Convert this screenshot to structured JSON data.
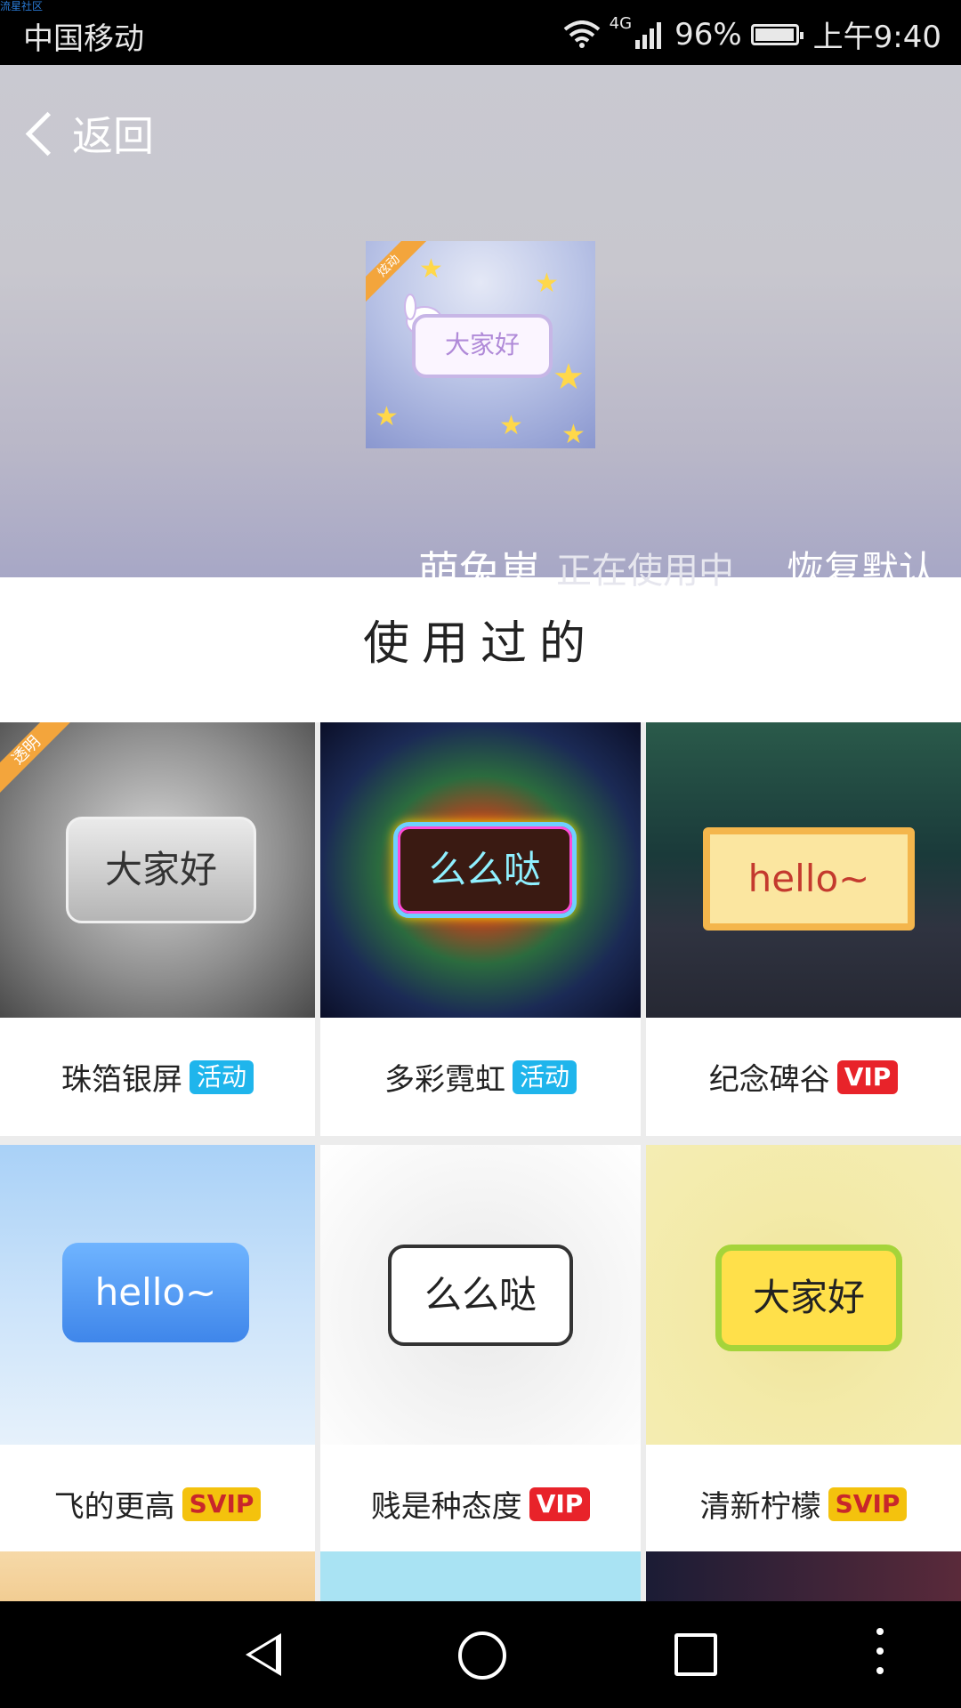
{
  "watermark": "流星社区",
  "status_bar": {
    "carrier": "中国移动",
    "network": "4G",
    "battery": "96%",
    "time": "上午9:40"
  },
  "header": {
    "back_label": "返回",
    "preview": {
      "ribbon": "炫动",
      "bubble_text": "大家好"
    },
    "current_name": "萌兔崽",
    "current_status": "正在使用中",
    "restore_label": "恢复默认"
  },
  "section": {
    "title": "使用过的"
  },
  "items": [
    {
      "name": "珠箔银屏",
      "badge": "活动",
      "badge_type": "activity",
      "sample": "大家好",
      "ribbon": "透明"
    },
    {
      "name": "多彩霓虹",
      "badge": "活动",
      "badge_type": "activity",
      "sample": "么么哒"
    },
    {
      "name": "纪念碑谷",
      "badge": "VIP",
      "badge_type": "vip",
      "sample": "hello~"
    },
    {
      "name": "飞的更高",
      "badge": "SVIP",
      "badge_type": "svip",
      "sample": "hello~"
    },
    {
      "name": "贱是种态度",
      "badge": "VIP",
      "badge_type": "vip",
      "sample": "么么哒"
    },
    {
      "name": "清新柠檬",
      "badge": "SVIP",
      "badge_type": "svip",
      "sample": "大家好"
    }
  ],
  "colors": {
    "activity": "#1fb5ec",
    "vip": "#e8232a",
    "svip": "#f4c20d"
  }
}
